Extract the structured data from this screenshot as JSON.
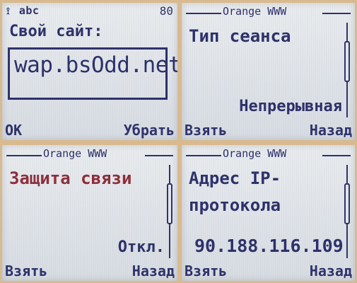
{
  "panels": [
    {
      "status_text": "abc",
      "status_icon": "signal-icon",
      "battery_text": "80",
      "label": "Свой сайт:",
      "input_value": "wap.bsOdd.net",
      "left_softkey": "OK",
      "right_softkey": "Убрать"
    },
    {
      "topbar_label": "Orange WWW",
      "title": "Тип сеанса",
      "value": "Непрерывная",
      "left_softkey": "Взять",
      "right_softkey": "Назад"
    },
    {
      "topbar_label": "Orange WWW",
      "title": "Защита связи",
      "value": "Откл.",
      "left_softkey": "Взять",
      "right_softkey": "Назад"
    },
    {
      "topbar_label": "Orange WWW",
      "title": "Адрес IP-\nпротокола",
      "value": "90.188.116.109",
      "left_softkey": "Взять",
      "right_softkey": "Назад"
    }
  ],
  "colors": {
    "background": "#d9b98e",
    "ink": "#2a2d66",
    "highlight": "#8b2b37",
    "screen": "#e3e7ed"
  }
}
